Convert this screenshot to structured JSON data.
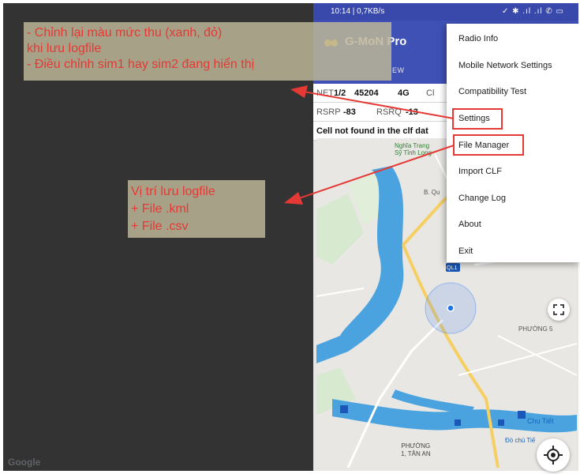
{
  "status_bar": {
    "time": "10:14 | 0,7KB/s",
    "icons": "✓ ✱ .ıl .ıl ✆ ▭"
  },
  "app": {
    "title": "G-MoN Pro",
    "tab_fragment": "EW"
  },
  "network_info": {
    "net_label": "NET",
    "sim": "1/2",
    "code": "45204",
    "tech": "4G",
    "trailing": "Cl",
    "rsrp_label": "RSRP",
    "rsrp": "-83",
    "rsrq_label": "RSRQ",
    "rsrq": "-13",
    "cell_message": "Cell not found in the clf dat"
  },
  "map": {
    "label_nghia_trang": [
      "Nghĩa Trang",
      "Sỹ Tỉnh Long"
    ],
    "road_b_quy": "B. Qu",
    "route_badge": "QL1",
    "place_phuong5": "PHƯỜNG 5",
    "place_chu_tiet": "Chu Tiết",
    "place_do_chu_tiet": "Đò chú Tiế",
    "place_phuong1": [
      "PHƯỜNG",
      "1, TÂN AN"
    ],
    "google_logo": "Google"
  },
  "menu": {
    "items": [
      "Radio Info",
      "Mobile Network Settings",
      "Compatibility Test",
      "Settings",
      "File Manager",
      "Import CLF",
      "Change Log",
      "About",
      "Exit"
    ]
  },
  "annotations": {
    "top": [
      "- Chỉnh lại màu mức thu (xanh, đỏ)",
      "khi lưu logfile",
      "- Điều chỉnh sim1 hay sim2 đang hiển thị"
    ],
    "middle": [
      "Vị trí lưu logfile",
      "+ File .kml",
      "+ File .csv"
    ]
  },
  "colors": {
    "app_bar": "#3f51b5",
    "status_bar": "#3949ab",
    "annotation_text": "#e53935",
    "annotation_bg": "#bcb596",
    "dark_panel": "#333333",
    "river": "#4aa3df"
  }
}
